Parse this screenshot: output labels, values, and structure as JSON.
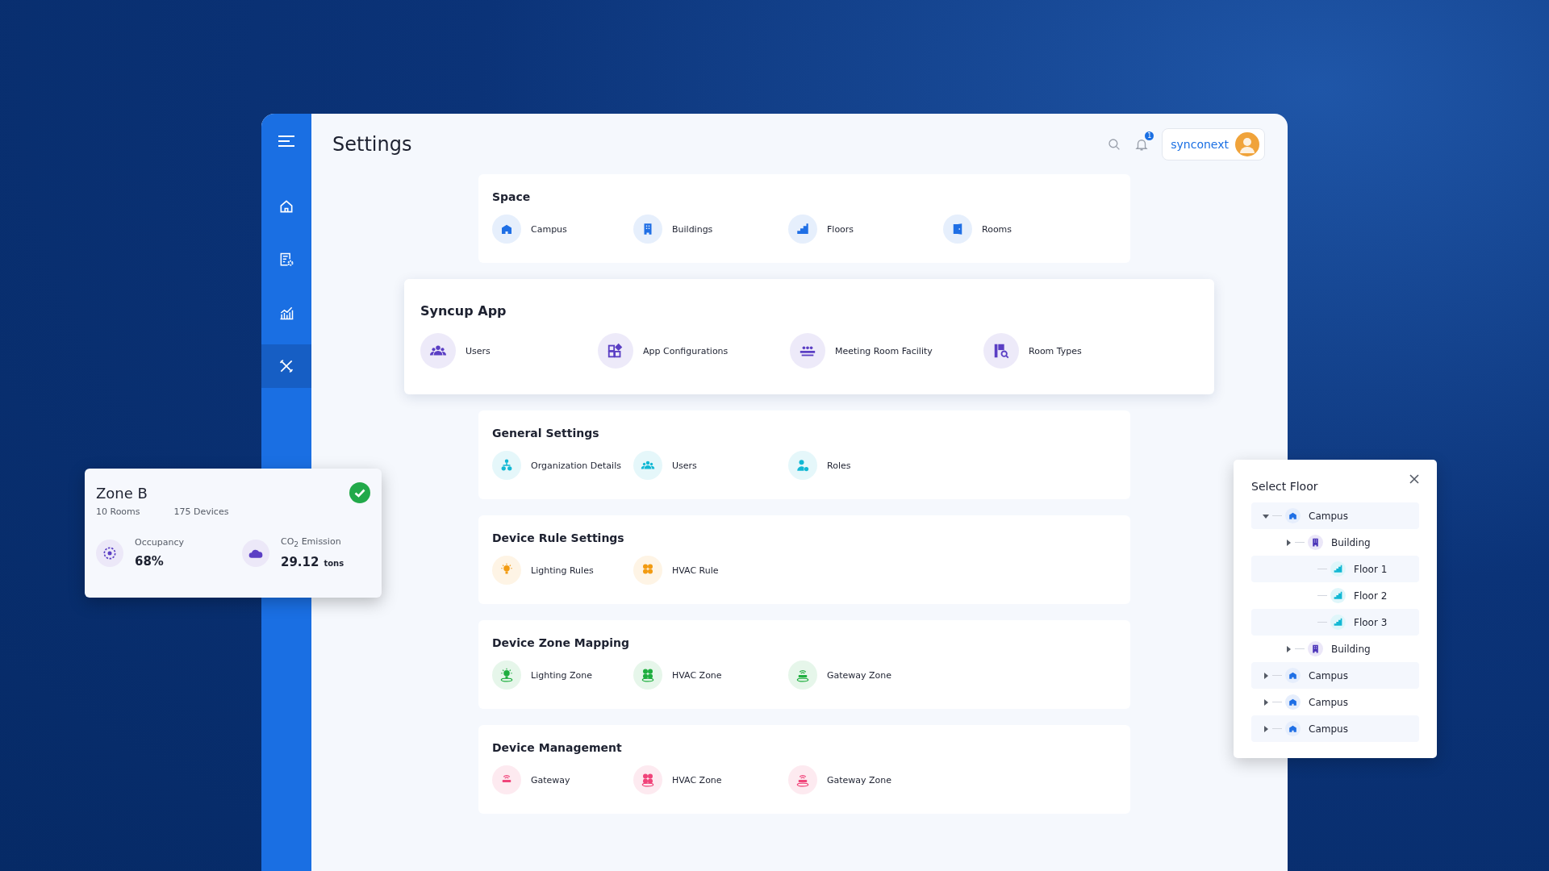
{
  "sidebar": {
    "items": [
      {
        "kind": "home",
        "selected": false
      },
      {
        "kind": "report",
        "selected": false
      },
      {
        "kind": "chart",
        "selected": false
      },
      {
        "kind": "tools",
        "selected": true
      }
    ]
  },
  "header": {
    "title": "Settings",
    "notifications": "1",
    "user": "synconext"
  },
  "sections": [
    {
      "title": "Space",
      "color": "#1f6fe5",
      "highlighted": false,
      "items": [
        {
          "label": "Campus",
          "kind": "campus"
        },
        {
          "label": "Buildings",
          "kind": "building"
        },
        {
          "label": "Floors",
          "kind": "floor"
        },
        {
          "label": "Rooms",
          "kind": "room"
        }
      ]
    },
    {
      "title": "Syncup App",
      "color": "#5b3fc4",
      "highlighted": true,
      "items": [
        {
          "label": "Users",
          "kind": "users"
        },
        {
          "label": "App Configurations",
          "kind": "config"
        },
        {
          "label": "Meeting Room Facility",
          "kind": "meeting"
        },
        {
          "label": "Room Types",
          "kind": "roomtypes"
        }
      ]
    },
    {
      "title": "General Settings",
      "color": "#12b8d4",
      "highlighted": false,
      "items": [
        {
          "label": "Organization Details",
          "kind": "org"
        },
        {
          "label": "Users",
          "kind": "users"
        },
        {
          "label": "Roles",
          "kind": "roles"
        }
      ]
    },
    {
      "title": "Device Rule Settings",
      "color": "#f29b12",
      "highlighted": false,
      "items": [
        {
          "label": "Lighting Rules",
          "kind": "bulb"
        },
        {
          "label": "HVAC Rule",
          "kind": "fan"
        }
      ]
    },
    {
      "title": "Device Zone Mapping",
      "color": "#1fae3f",
      "highlighted": false,
      "items": [
        {
          "label": "Lighting Zone",
          "kind": "bulbzone"
        },
        {
          "label": "HVAC Zone",
          "kind": "fanzone"
        },
        {
          "label": "Gateway Zone",
          "kind": "gatewayzone"
        }
      ]
    },
    {
      "title": "Device Management",
      "color": "#f0447a",
      "highlighted": false,
      "items": [
        {
          "label": "Gateway",
          "kind": "gateway"
        },
        {
          "label": "HVAC Zone",
          "kind": "fanzone"
        },
        {
          "label": "Gateway Zone",
          "kind": "gatewayzone"
        }
      ]
    }
  ],
  "zone_card": {
    "title": "Zone B",
    "rooms": "10 Rooms",
    "devices": "175 Devices",
    "ok": true,
    "metrics": [
      {
        "kind": "occupancy",
        "label": "Occupancy",
        "value": "68%"
      },
      {
        "kind": "co2",
        "label": "CO$_{2}$ Emission",
        "value": "29.12",
        "unit": "tons"
      }
    ]
  },
  "select_floor": {
    "title": "Select Floor",
    "tree": [
      {
        "label": "Campus",
        "kind": "campus",
        "expanded": true,
        "children": [
          {
            "label": "Building",
            "kind": "building",
            "expanded": false,
            "children": [
              {
                "label": "Floor 1",
                "kind": "floor"
              },
              {
                "label": "Floor 2",
                "kind": "floor"
              },
              {
                "label": "Floor 3",
                "kind": "floor"
              }
            ]
          },
          {
            "label": "Building",
            "kind": "building",
            "expanded": false
          }
        ]
      },
      {
        "label": "Campus",
        "kind": "campus",
        "expanded": false
      },
      {
        "label": "Campus",
        "kind": "campus",
        "expanded": false
      },
      {
        "label": "Campus",
        "kind": "campus",
        "expanded": false
      }
    ]
  }
}
